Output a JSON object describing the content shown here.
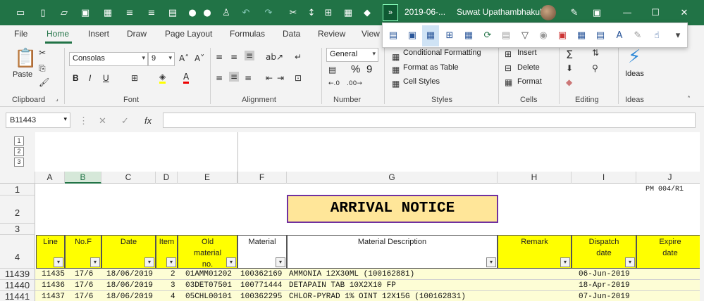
{
  "titlebar": {
    "file_name": "2019-06-...",
    "user_name": "Suwat Upathambhakul",
    "more_label": "»",
    "icons": [
      "window-icon",
      "new-file-icon",
      "open-file-icon",
      "save-icon",
      "border-icon",
      "indent-icon",
      "merge-icon",
      "outdent-icon",
      "circle-icon",
      "circle-icon",
      "print-preview-icon",
      "undo-icon",
      "redo-icon",
      "format-painter-icon",
      "sort-icon",
      "grid-icon",
      "table-icon",
      "fill-color-icon"
    ]
  },
  "tabs": [
    "File",
    "Home",
    "Insert",
    "Draw",
    "Page Layout",
    "Formulas",
    "Data",
    "Review",
    "View"
  ],
  "ribbon": {
    "clipboard": {
      "paste": "Paste",
      "group": "Clipboard"
    },
    "font": {
      "name": "Consolas",
      "size": "9",
      "group": "Font",
      "bold": "B",
      "italic": "I",
      "underline": "U",
      "grow": "A^",
      "shrink": "A˅"
    },
    "alignment": {
      "group": "Alignment"
    },
    "number": {
      "format": "General",
      "group": "Number",
      "percent": "%",
      "comma": "9"
    },
    "styles": {
      "conditional": "Conditional Formatting",
      "format_table": "Format as Table",
      "cell_styles": "Cell Styles",
      "group": "Styles"
    },
    "cells": {
      "insert": "Insert",
      "delete": "Delete",
      "format": "Format",
      "group": "Cells"
    },
    "editing": {
      "group": "Editing"
    },
    "ideas": {
      "label": "Ideas",
      "group": "Ideas"
    }
  },
  "formula_bar": {
    "name_box": "B11443",
    "fx": "fx",
    "value": ""
  },
  "outline_levels": [
    "1",
    "2",
    "3"
  ],
  "columns": [
    "A",
    "B",
    "C",
    "D",
    "E",
    "F",
    "G",
    "H",
    "I",
    "J"
  ],
  "selected_column": "B",
  "rows": [
    "1",
    "2",
    "3",
    "4",
    "11439",
    "11440",
    "11441"
  ],
  "sheet": {
    "title": "ARRIVAL NOTICE",
    "pm_code": "PM 004/R1",
    "headers": [
      "Line",
      "No.F",
      "Date",
      "Item",
      "Old material no.",
      "Material",
      "Material Description",
      "Remark",
      "Dispatch date",
      "Expire date"
    ],
    "data": [
      {
        "line": "11435",
        "nof": "17/6",
        "date": "18/06/2019",
        "item": "2",
        "old": "01AMM01202",
        "material": "100362169",
        "desc": "AMMONIA 12X30ML (100162881)",
        "remark": "",
        "dispatch": "06-Jun-2019"
      },
      {
        "line": "11436",
        "nof": "17/6",
        "date": "18/06/2019",
        "item": "3",
        "old": "03DET07501",
        "material": "100771444",
        "desc": "DETAPAIN TAB 10X2X10 FP",
        "remark": "",
        "dispatch": "18-Apr-2019"
      },
      {
        "line": "11437",
        "nof": "17/6",
        "date": "18/06/2019",
        "item": "4",
        "old": "05CHL00101",
        "material": "100362295",
        "desc": "CHLOR-PYRAD 1% OINT 12X15G (100162831)",
        "remark": "",
        "dispatch": "07-Jun-2019"
      }
    ]
  }
}
